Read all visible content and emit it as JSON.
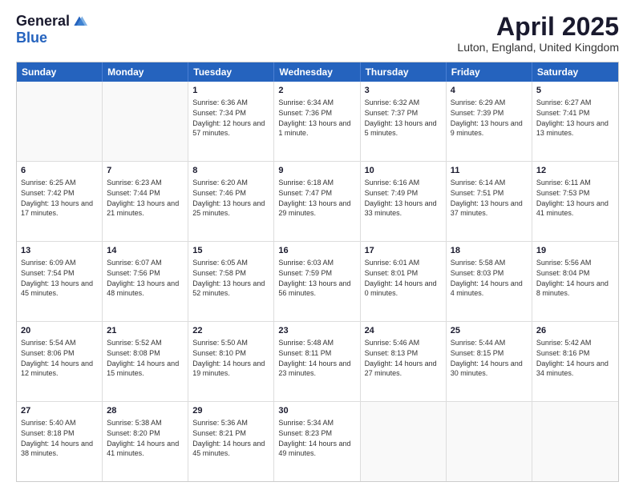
{
  "logo": {
    "general": "General",
    "blue": "Blue"
  },
  "title": "April 2025",
  "location": "Luton, England, United Kingdom",
  "weekdays": [
    "Sunday",
    "Monday",
    "Tuesday",
    "Wednesday",
    "Thursday",
    "Friday",
    "Saturday"
  ],
  "rows": [
    [
      {
        "day": "",
        "text": ""
      },
      {
        "day": "",
        "text": ""
      },
      {
        "day": "1",
        "text": "Sunrise: 6:36 AM\nSunset: 7:34 PM\nDaylight: 12 hours and 57 minutes."
      },
      {
        "day": "2",
        "text": "Sunrise: 6:34 AM\nSunset: 7:36 PM\nDaylight: 13 hours and 1 minute."
      },
      {
        "day": "3",
        "text": "Sunrise: 6:32 AM\nSunset: 7:37 PM\nDaylight: 13 hours and 5 minutes."
      },
      {
        "day": "4",
        "text": "Sunrise: 6:29 AM\nSunset: 7:39 PM\nDaylight: 13 hours and 9 minutes."
      },
      {
        "day": "5",
        "text": "Sunrise: 6:27 AM\nSunset: 7:41 PM\nDaylight: 13 hours and 13 minutes."
      }
    ],
    [
      {
        "day": "6",
        "text": "Sunrise: 6:25 AM\nSunset: 7:42 PM\nDaylight: 13 hours and 17 minutes."
      },
      {
        "day": "7",
        "text": "Sunrise: 6:23 AM\nSunset: 7:44 PM\nDaylight: 13 hours and 21 minutes."
      },
      {
        "day": "8",
        "text": "Sunrise: 6:20 AM\nSunset: 7:46 PM\nDaylight: 13 hours and 25 minutes."
      },
      {
        "day": "9",
        "text": "Sunrise: 6:18 AM\nSunset: 7:47 PM\nDaylight: 13 hours and 29 minutes."
      },
      {
        "day": "10",
        "text": "Sunrise: 6:16 AM\nSunset: 7:49 PM\nDaylight: 13 hours and 33 minutes."
      },
      {
        "day": "11",
        "text": "Sunrise: 6:14 AM\nSunset: 7:51 PM\nDaylight: 13 hours and 37 minutes."
      },
      {
        "day": "12",
        "text": "Sunrise: 6:11 AM\nSunset: 7:53 PM\nDaylight: 13 hours and 41 minutes."
      }
    ],
    [
      {
        "day": "13",
        "text": "Sunrise: 6:09 AM\nSunset: 7:54 PM\nDaylight: 13 hours and 45 minutes."
      },
      {
        "day": "14",
        "text": "Sunrise: 6:07 AM\nSunset: 7:56 PM\nDaylight: 13 hours and 48 minutes."
      },
      {
        "day": "15",
        "text": "Sunrise: 6:05 AM\nSunset: 7:58 PM\nDaylight: 13 hours and 52 minutes."
      },
      {
        "day": "16",
        "text": "Sunrise: 6:03 AM\nSunset: 7:59 PM\nDaylight: 13 hours and 56 minutes."
      },
      {
        "day": "17",
        "text": "Sunrise: 6:01 AM\nSunset: 8:01 PM\nDaylight: 14 hours and 0 minutes."
      },
      {
        "day": "18",
        "text": "Sunrise: 5:58 AM\nSunset: 8:03 PM\nDaylight: 14 hours and 4 minutes."
      },
      {
        "day": "19",
        "text": "Sunrise: 5:56 AM\nSunset: 8:04 PM\nDaylight: 14 hours and 8 minutes."
      }
    ],
    [
      {
        "day": "20",
        "text": "Sunrise: 5:54 AM\nSunset: 8:06 PM\nDaylight: 14 hours and 12 minutes."
      },
      {
        "day": "21",
        "text": "Sunrise: 5:52 AM\nSunset: 8:08 PM\nDaylight: 14 hours and 15 minutes."
      },
      {
        "day": "22",
        "text": "Sunrise: 5:50 AM\nSunset: 8:10 PM\nDaylight: 14 hours and 19 minutes."
      },
      {
        "day": "23",
        "text": "Sunrise: 5:48 AM\nSunset: 8:11 PM\nDaylight: 14 hours and 23 minutes."
      },
      {
        "day": "24",
        "text": "Sunrise: 5:46 AM\nSunset: 8:13 PM\nDaylight: 14 hours and 27 minutes."
      },
      {
        "day": "25",
        "text": "Sunrise: 5:44 AM\nSunset: 8:15 PM\nDaylight: 14 hours and 30 minutes."
      },
      {
        "day": "26",
        "text": "Sunrise: 5:42 AM\nSunset: 8:16 PM\nDaylight: 14 hours and 34 minutes."
      }
    ],
    [
      {
        "day": "27",
        "text": "Sunrise: 5:40 AM\nSunset: 8:18 PM\nDaylight: 14 hours and 38 minutes."
      },
      {
        "day": "28",
        "text": "Sunrise: 5:38 AM\nSunset: 8:20 PM\nDaylight: 14 hours and 41 minutes."
      },
      {
        "day": "29",
        "text": "Sunrise: 5:36 AM\nSunset: 8:21 PM\nDaylight: 14 hours and 45 minutes."
      },
      {
        "day": "30",
        "text": "Sunrise: 5:34 AM\nSunset: 8:23 PM\nDaylight: 14 hours and 49 minutes."
      },
      {
        "day": "",
        "text": ""
      },
      {
        "day": "",
        "text": ""
      },
      {
        "day": "",
        "text": ""
      }
    ]
  ]
}
